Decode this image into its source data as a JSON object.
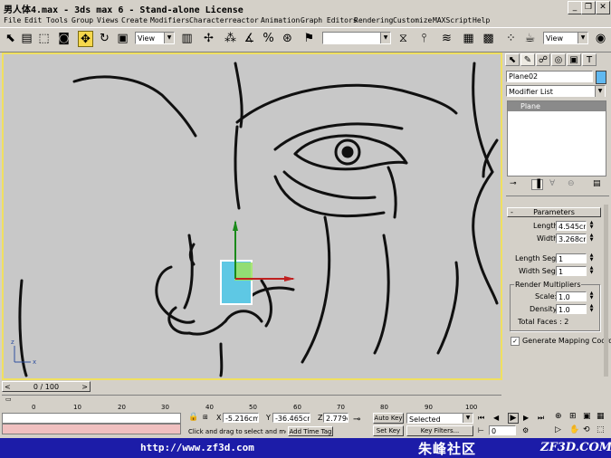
{
  "window": {
    "title": "男人体4.max - 3ds max 6 - Stand-alone License",
    "controls": [
      "minimize-icon",
      "restore-icon",
      "close-icon"
    ]
  },
  "menu": [
    "File",
    "Edit",
    "Tools",
    "Group",
    "Views",
    "Create",
    "Modifiers",
    "Character",
    "reactor",
    "Animation",
    "Graph Editors",
    "Rendering",
    "Customize",
    "MAXScript",
    "Help"
  ],
  "toolbar": {
    "ref_coord": "View",
    "named_selection": "",
    "view_right": "View"
  },
  "command_panel": {
    "object_name": "Plane02",
    "modifier_list": "Modifier List",
    "stack_item": "Plane",
    "rollout_title": "Parameters",
    "length_label": "Length:",
    "length_value": "4.545cm",
    "width_label": "Width:",
    "width_value": "3.268cm",
    "length_segs_label": "Length Segs:",
    "length_segs_value": "1",
    "width_segs_label": "Width Segs:",
    "width_segs_value": "1",
    "render_multipliers_label": "Render Multipliers",
    "scale_label": "Scale:",
    "scale_value": "1.0",
    "density_label": "Density:",
    "density_value": "1.0",
    "total_faces": "Total Faces : 2",
    "generate_mapping": "Generate Mapping Coords.",
    "generate_mapping_checked": true
  },
  "timeline": {
    "frame_display": "0 / 100",
    "ticks": [
      "0",
      "10",
      "20",
      "30",
      "40",
      "50",
      "60",
      "70",
      "80",
      "90",
      "100"
    ]
  },
  "status": {
    "x_label": "X",
    "x_value": "-5.216cm",
    "y_label": "Y",
    "y_value": "-36.465cm",
    "z_label": "Z",
    "z_value": "2.779cm",
    "prompt": "Click and drag to select and move",
    "add_time_tag": "Add Time Tag",
    "auto_key": "Auto Key",
    "set_key": "Set Key",
    "key_filters": "Key Filters...",
    "selected_combo": "Selected",
    "frame_field": "0"
  },
  "watermark": {
    "url": "http://www.zf3d.com",
    "site_cn": "朱峰社区",
    "site_en": "ZF3D.COM"
  }
}
